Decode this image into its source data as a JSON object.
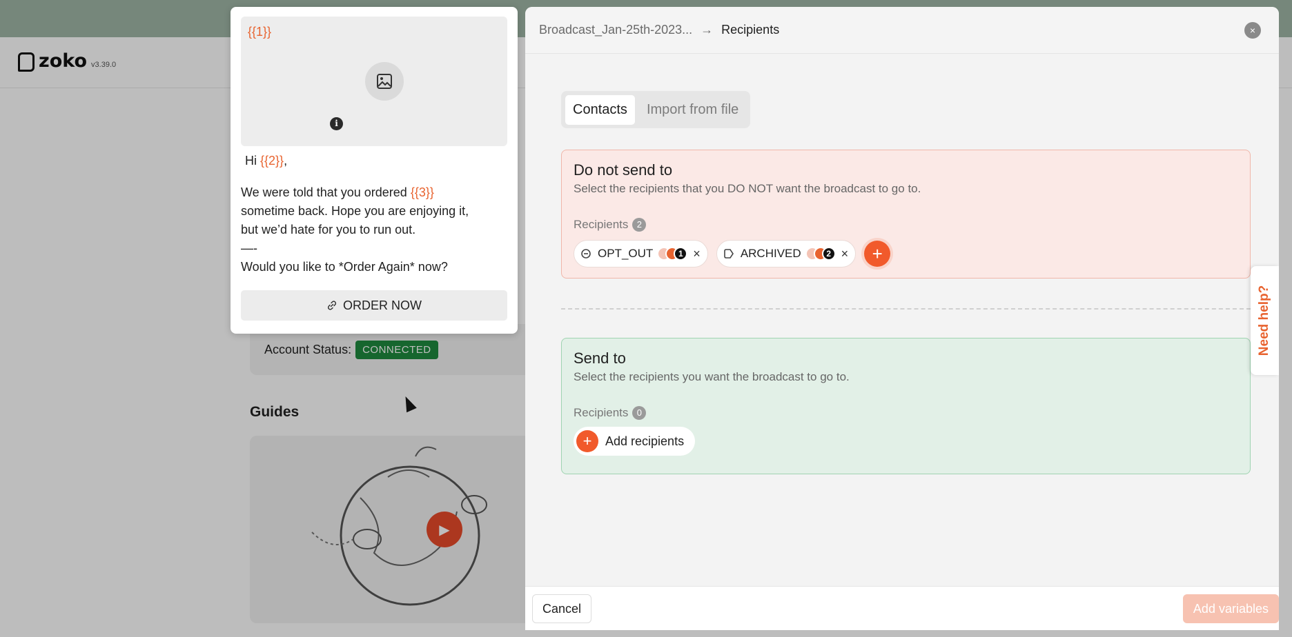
{
  "background": {
    "brand": "zoko",
    "version": "v3.39.0",
    "account_status_label": "Account Status:",
    "account_status_value": "CONNECTED",
    "guides_title": "Guides"
  },
  "preview": {
    "header_var": "{{1}}",
    "greeting_prefix": "Hi ",
    "greeting_var": "{{2}}",
    "greeting_suffix": ",",
    "line1_prefix": "We were told that you ordered ",
    "line1_var": "{{3}}",
    "line2": "sometime back. Hope you are enjoying it,",
    "line3": "but we’d hate for you to run out.",
    "line4": "—-",
    "line5": "Would you like to *Order Again* now?",
    "button_label": "ORDER NOW",
    "info_glyph": "i"
  },
  "panel": {
    "breadcrumb_broadcast": "Broadcast_Jan-25th-2023...",
    "breadcrumb_arrow": "→",
    "breadcrumb_current": "Recipients",
    "close_glyph": "×",
    "tabs": [
      {
        "label": "Contacts",
        "active": true
      },
      {
        "label": "Import from file",
        "active": false
      }
    ],
    "do_not_send": {
      "title": "Do not send to",
      "subtitle": "Select the recipients that you DO NOT want the broadcast to go to.",
      "recipients_label": "Recipients",
      "recipients_count": "2",
      "chips": [
        {
          "label": "OPT_OUT",
          "count": "1"
        },
        {
          "label": "ARCHIVED",
          "count": "2"
        }
      ],
      "remove_glyph": "×",
      "add_glyph": "+"
    },
    "send_to": {
      "title": "Send to",
      "subtitle": "Select the recipients you want the broadcast to go to.",
      "recipients_label": "Recipients",
      "recipients_count": "0",
      "add_label": "Add recipients",
      "add_glyph": "+"
    },
    "need_help": "Need help?",
    "cancel_label": "Cancel",
    "add_variables_label": "Add variables"
  },
  "colors": {
    "accent": "#e8632f",
    "danger_bg": "#fbe9e6",
    "success_bg": "#e2f0e7",
    "connected": "#1e8a3e"
  }
}
